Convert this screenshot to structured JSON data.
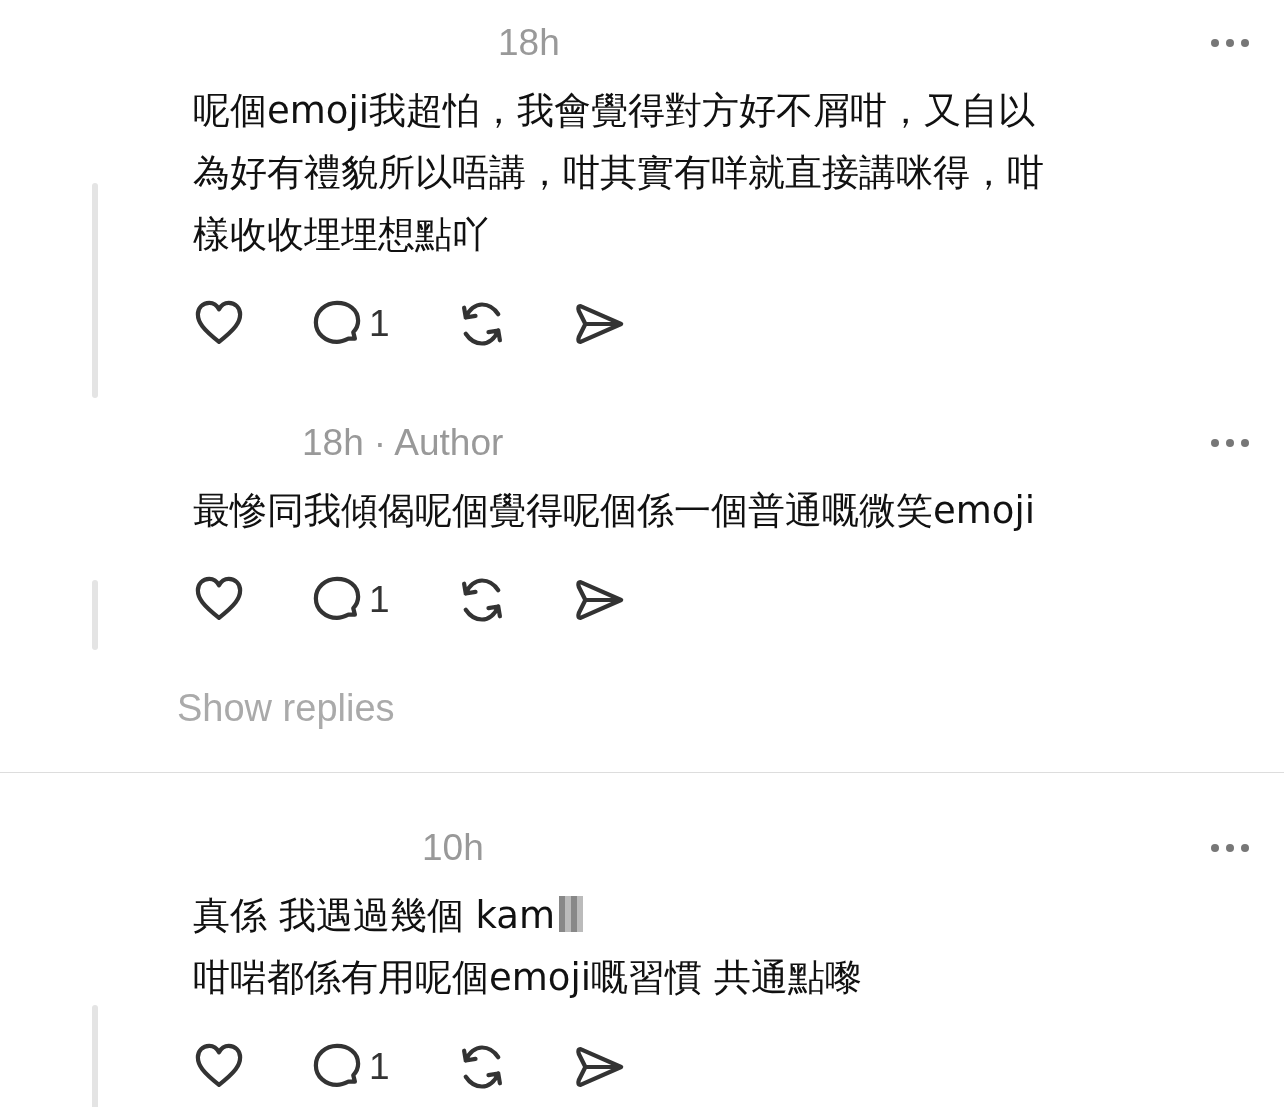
{
  "comments": [
    {
      "time": "18h",
      "lines": [
        "呢個emoji我超怕，我會覺得對方好不屑咁，又自以",
        "為好有禮貌所以唔講，咁其實有咩就直接講咪得，咁",
        "樣收收埋埋想點吖"
      ],
      "liked": false,
      "reply_count": "1"
    },
    {
      "time": "18h",
      "author_badge": "· Author",
      "lines": [
        "最慘同我傾偈呢個覺得呢個係一個普通嘅微笑emoji"
      ],
      "liked": false,
      "reply_count": "1",
      "show_replies": "Show replies"
    },
    {
      "time": "10h",
      "lines": [
        "真係 我遇過幾個 kam",
        "咁啱都係有用呢個emoji嘅習慣 共通點嚟"
      ],
      "redacted": true,
      "liked": false,
      "reply_count": "1"
    }
  ]
}
